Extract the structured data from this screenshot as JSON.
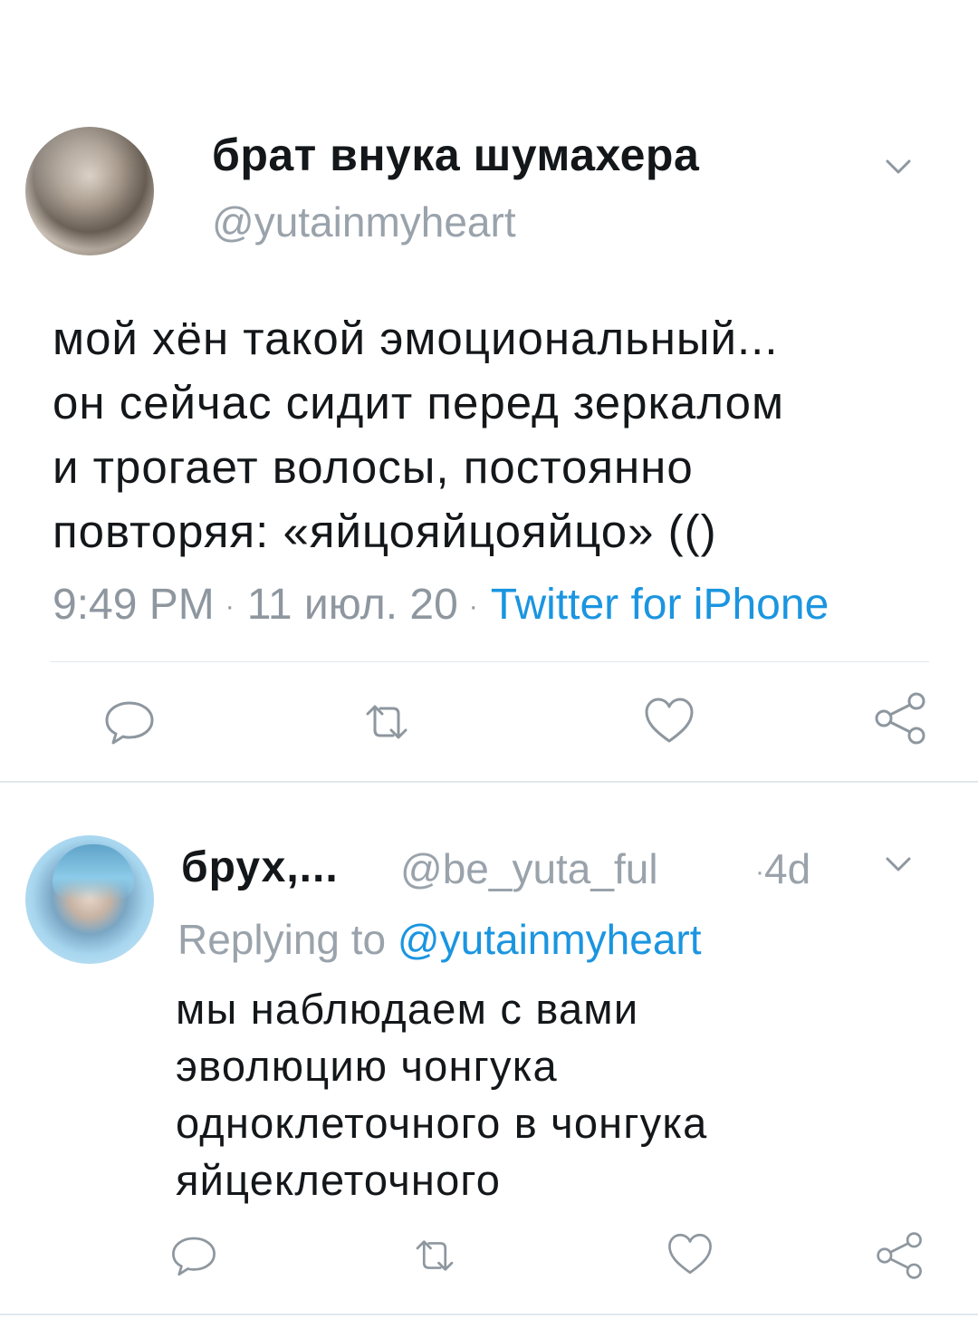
{
  "tweet": {
    "display_name": "брат внука шумахера",
    "handle": "@yutainmyheart",
    "text": "мой хён такой эмоциональный...\nон сейчас сидит перед зеркалом\nи трогает волосы, постоянно\nповторяя: «яйцояйцояйцо» (()",
    "time": "9:49 PM",
    "date": "11 июл. 20",
    "source": "Twitter for iPhone",
    "separator": "·"
  },
  "reply": {
    "display_name": "брух,...",
    "handle": "@be_yuta_ful",
    "age": "4d",
    "separator": "·",
    "replying_label": "Replying to",
    "replying_to": "@yutainmyheart",
    "text": "мы наблюдаем с вами\nэволюцию чонгука\nодноклеточного в чонгука\nяйцеклеточного"
  },
  "icons": [
    "chevron-down-icon",
    "reply-icon",
    "retweet-icon",
    "like-icon",
    "share-icon"
  ],
  "colors": {
    "link": "#1b95e0",
    "muted": "#8e979f",
    "text": "#14171a",
    "divider": "#e1e8ed"
  }
}
